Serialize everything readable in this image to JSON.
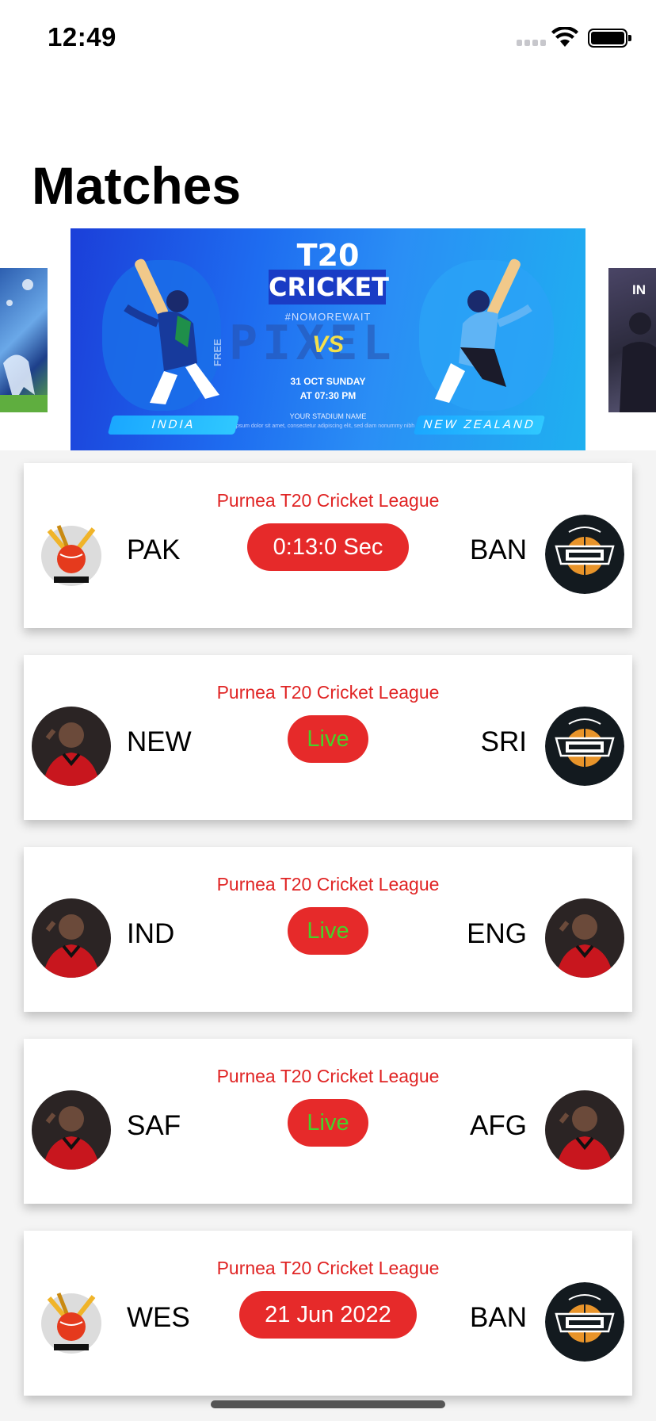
{
  "status_bar": {
    "time": "12:49"
  },
  "page": {
    "title": "Matches"
  },
  "carousel": {
    "side_right_text": "IN",
    "banner": {
      "headline": "T20",
      "subheadline": "CRICKET",
      "hashtag": "#NOMOREWAIT",
      "watermark": "PIXEL",
      "watermark_tag": "FREE",
      "vs": "VS",
      "date_line1": "31 OCT SUNDAY",
      "date_line2": "AT 07:30 PM",
      "venue": "YOUR STADIUM NAME",
      "venue_sub": "Lorem ipsum dolor sit amet, consectetur adipiscing elit, sed diam nonummy nibh euismod.",
      "team_left": "INDIA",
      "team_right": "NEW ZEALAND"
    }
  },
  "matches": [
    {
      "league": "Purnea T20 Cricket League",
      "team_left": "PAK",
      "team_right": "BAN",
      "status": "0:13:0 Sec",
      "status_style": "timer",
      "avatar_left": "cricket-logo-icon",
      "avatar_right": "fantasy-basketball-logo-icon"
    },
    {
      "league": "Purnea T20 Cricket League",
      "team_left": "NEW",
      "team_right": "SRI",
      "status": "Live",
      "status_style": "live",
      "avatar_left": "player-photo-icon",
      "avatar_right": "fantasy-basketball-logo-icon"
    },
    {
      "league": "Purnea T20 Cricket League",
      "team_left": "IND",
      "team_right": "ENG",
      "status": "Live",
      "status_style": "live",
      "avatar_left": "player-photo-icon",
      "avatar_right": "player-photo-icon"
    },
    {
      "league": "Purnea T20 Cricket League",
      "team_left": "SAF",
      "team_right": "AFG",
      "status": "Live",
      "status_style": "live",
      "avatar_left": "player-photo-icon",
      "avatar_right": "player-photo-icon"
    },
    {
      "league": "Purnea T20 Cricket League",
      "team_left": "WES",
      "team_right": "BAN",
      "status": "21 Jun 2022",
      "status_style": "date",
      "avatar_left": "cricket-logo-icon",
      "avatar_right": "fantasy-basketball-logo-icon"
    }
  ],
  "colors": {
    "accent_red": "#e62a2a",
    "league_red": "#e02424",
    "live_green": "#46d12a"
  }
}
